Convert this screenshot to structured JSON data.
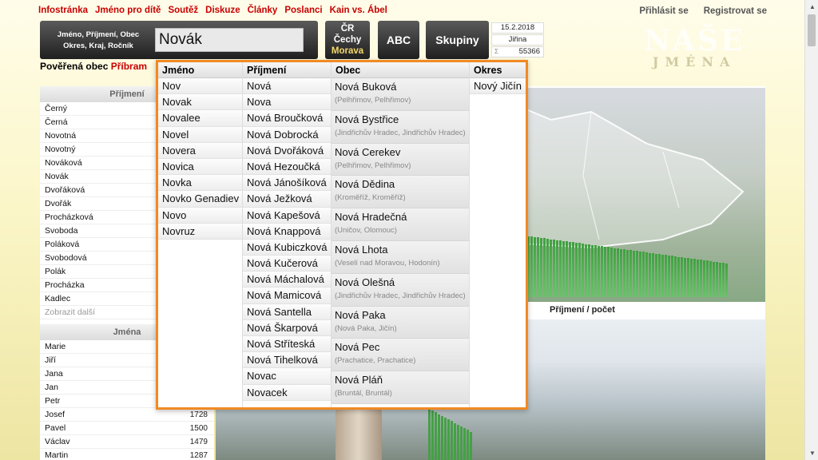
{
  "nav": {
    "items": [
      "Infostránka",
      "Jméno pro dítě",
      "Soutěž",
      "Diskuze",
      "Články",
      "Poslanci",
      "Kain vs. Ábel"
    ],
    "login": "Přihlásit se",
    "register": "Registrovat se"
  },
  "search": {
    "hint_line1": "Jméno, Příjmení, Obec",
    "hint_line2": "Okres, Kraj, Ročník",
    "value": "Novák"
  },
  "buttons": {
    "region_l1": "ČR",
    "region_l2": "Čechy",
    "region_l3": "Morava",
    "abc": "ABC",
    "groups": "Skupiny"
  },
  "info": {
    "date": "15.2.2018",
    "nameday": "Jiřina",
    "sigma": "Σ",
    "count": "55366"
  },
  "logo": {
    "line1": "NAŠE",
    "line2": "JMÉNA"
  },
  "obec": {
    "label": "Pověřená obec",
    "name": "Příbram"
  },
  "surnames": {
    "header": "Příjmení",
    "items": [
      "Černý",
      "Černá",
      "Novotná",
      "Novotný",
      "Nováková",
      "Novák",
      "Dvořáková",
      "Dvořák",
      "Procházková",
      "Svoboda",
      "Poláková",
      "Svobodová",
      "Polák",
      "Procházka",
      "Kadlec"
    ],
    "more": "Zobrazit další"
  },
  "firstnames": {
    "header": "Jména",
    "items": [
      {
        "name": "Marie",
        "count": ""
      },
      {
        "name": "Jiří",
        "count": ""
      },
      {
        "name": "Jana",
        "count": ""
      },
      {
        "name": "Jan",
        "count": ""
      },
      {
        "name": "Petr",
        "count": ""
      },
      {
        "name": "Josef",
        "count": "1728"
      },
      {
        "name": "Pavel",
        "count": "1500"
      },
      {
        "name": "Václav",
        "count": "1479"
      },
      {
        "name": "Martin",
        "count": "1287"
      }
    ]
  },
  "stats_label": "Příjmení / počet",
  "dropdown": {
    "col_jmeno": "Jméno",
    "col_prijmeni": "Příjmení",
    "col_obec": "Obec",
    "col_okres": "Okres",
    "jmena": [
      "Nov",
      "Novak",
      "Novalee",
      "Novel",
      "Novera",
      "Novica",
      "Novka",
      "Novko Genadiev",
      "Novo",
      "Novruz"
    ],
    "prijmeni": [
      "Nová",
      "Nova",
      "Nová Broučková",
      "Nová Dobrocká",
      "Nová Dvořáková",
      "Nová Hezoučká",
      "Nová Jánošíková",
      "Nová Ježková",
      "Nová Kapešová",
      "Nová Knappová",
      "Nová Kubiczková",
      "Nová Kučerová",
      "Nová Máchalová",
      "Nová Mamicová",
      "Nová Santella",
      "Nová Škarpová",
      "Nová Stříteská",
      "Nová Tihelková",
      "Novac",
      "Novacek"
    ],
    "obce": [
      {
        "name": "Nová Buková",
        "sub": "(Pelhřimov, Pelhřimov)"
      },
      {
        "name": "Nová Bystřice",
        "sub": "(Jindřichův Hradec, Jindřichův Hradec)"
      },
      {
        "name": "Nová Cerekev",
        "sub": "(Pelhřimov, Pelhřimov)"
      },
      {
        "name": "Nová Dědina",
        "sub": "(Kroměříž, Kroměříž)"
      },
      {
        "name": "Nová Hradečná",
        "sub": "(Uničov, Olomouc)"
      },
      {
        "name": "Nová Lhota",
        "sub": "(Veselí nad Moravou, Hodonín)"
      },
      {
        "name": "Nová Olešná",
        "sub": "(Jindřichův Hradec, Jindřichův Hradec)"
      },
      {
        "name": "Nová Paka",
        "sub": "(Nová Paka, Jičín)"
      },
      {
        "name": "Nová Pec",
        "sub": "(Prachatice, Prachatice)"
      },
      {
        "name": "Nová Pláň",
        "sub": "(Bruntál, Bruntál)"
      }
    ],
    "okresy": [
      "Nový Jičín"
    ]
  }
}
